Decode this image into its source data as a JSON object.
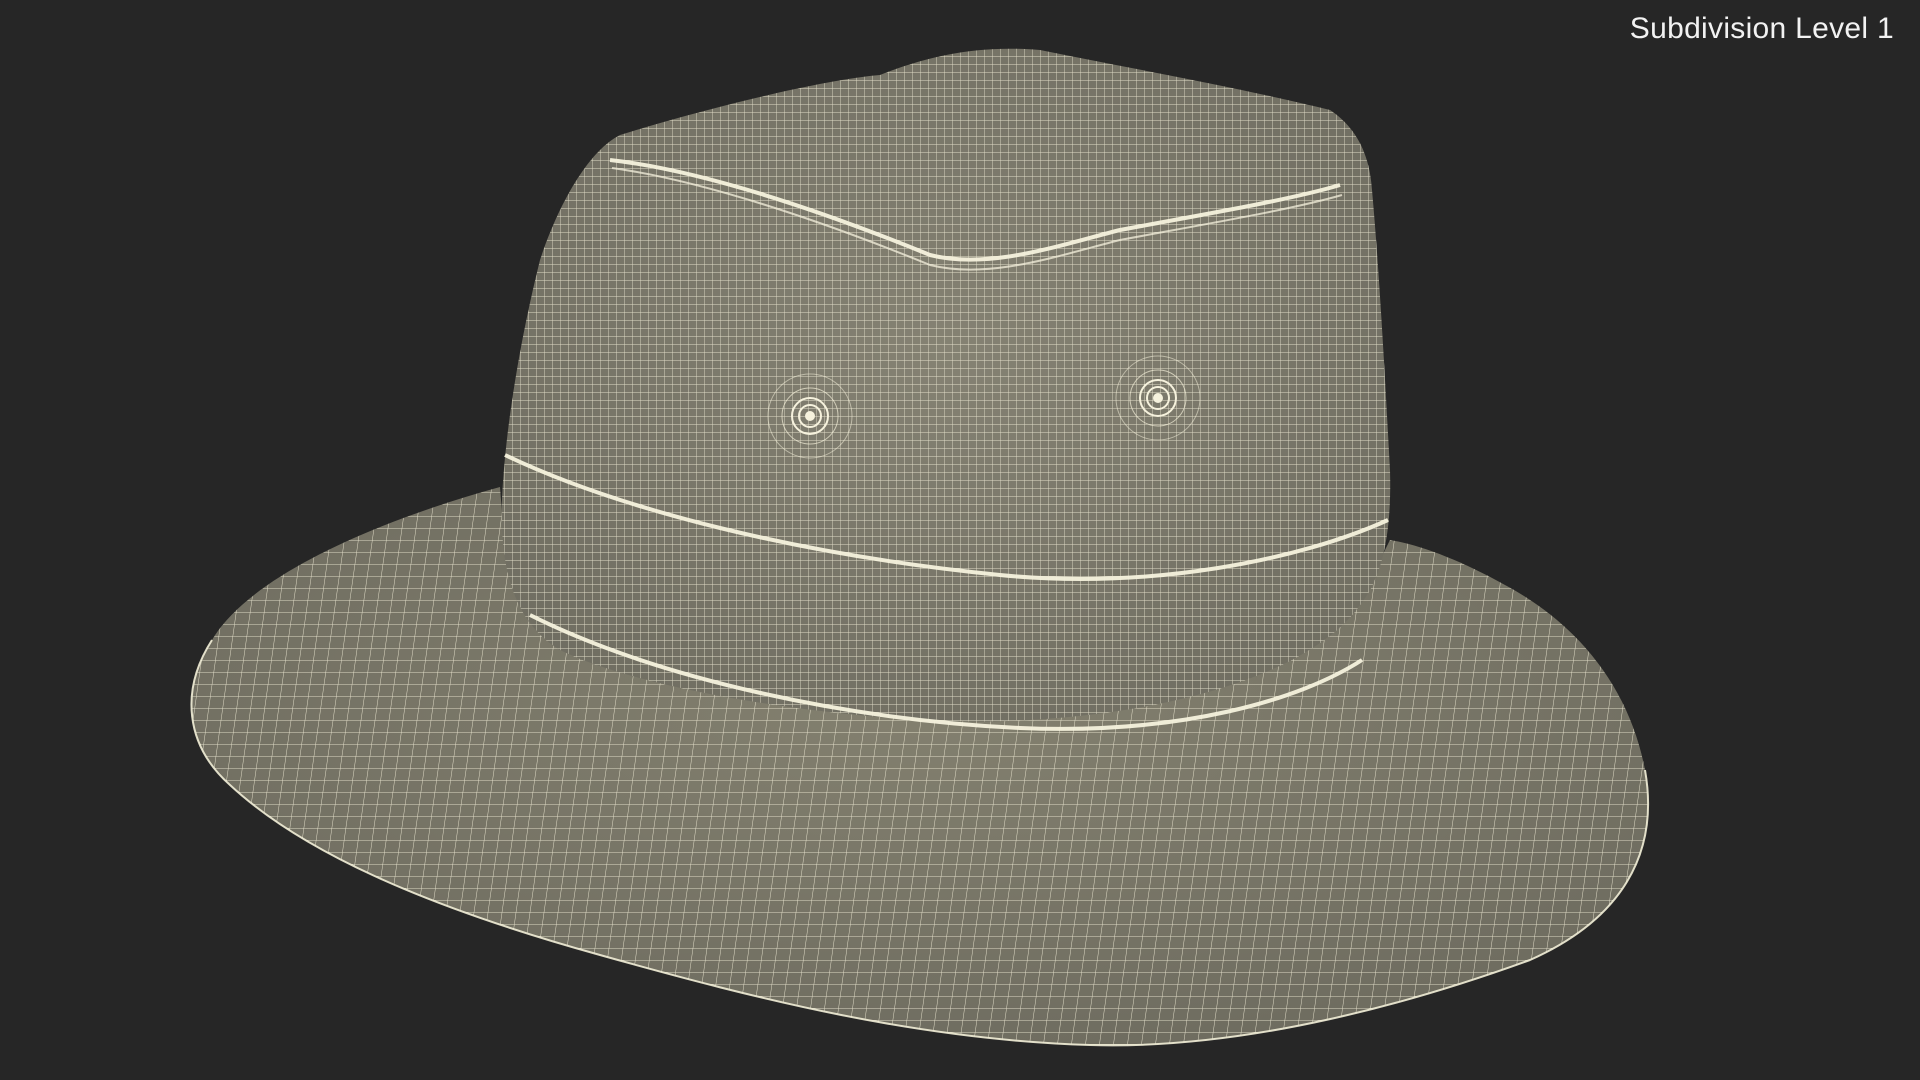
{
  "viewport": {
    "subdivision_label": "Subdivision Level 1",
    "background_color": "#262626",
    "mesh_fill_color": "#7c7a6c",
    "wire_color": "#f3efd8"
  },
  "model": {
    "object": "bucket-hat",
    "render_style": "wireframe-over-shaded"
  }
}
